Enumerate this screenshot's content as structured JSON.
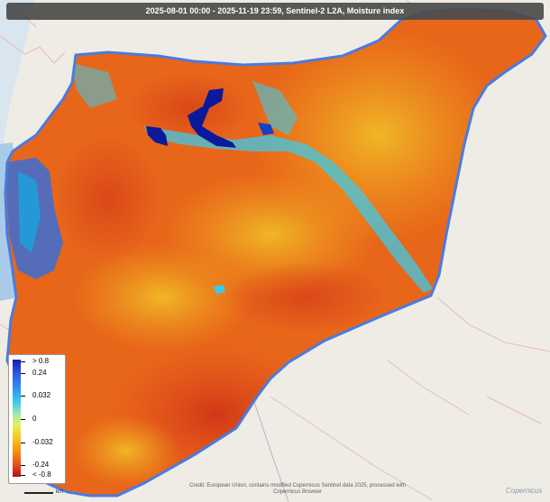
{
  "title": "2025-08-01 00:00 - 2025-11-19 23:59, Sentinel-2 L2A, Moisture index",
  "legend": {
    "labels": [
      "> 0.8",
      "0.24",
      "0.032",
      "0",
      "-0.032",
      "-0.24",
      "< -0.8"
    ],
    "ramp_colors": [
      "#1a1ab0",
      "#2a5be0",
      "#2f8ff0",
      "#3ec9e8",
      "#9fe6b8",
      "#e7f05a",
      "#f7c21a",
      "#f28a10",
      "#e0401a",
      "#b01010"
    ]
  },
  "scale_label": "km",
  "attribution": "Credit: European Union, contains modified Copernicus Sentinel data 2025, processed with Copernicus Browser",
  "logo": "Copernicus",
  "colors": {
    "basemap": "#efece6",
    "sea": "#aacbe8",
    "border": "#4a7be0",
    "water": "#0a1a9a",
    "dry": "#e8661a"
  }
}
